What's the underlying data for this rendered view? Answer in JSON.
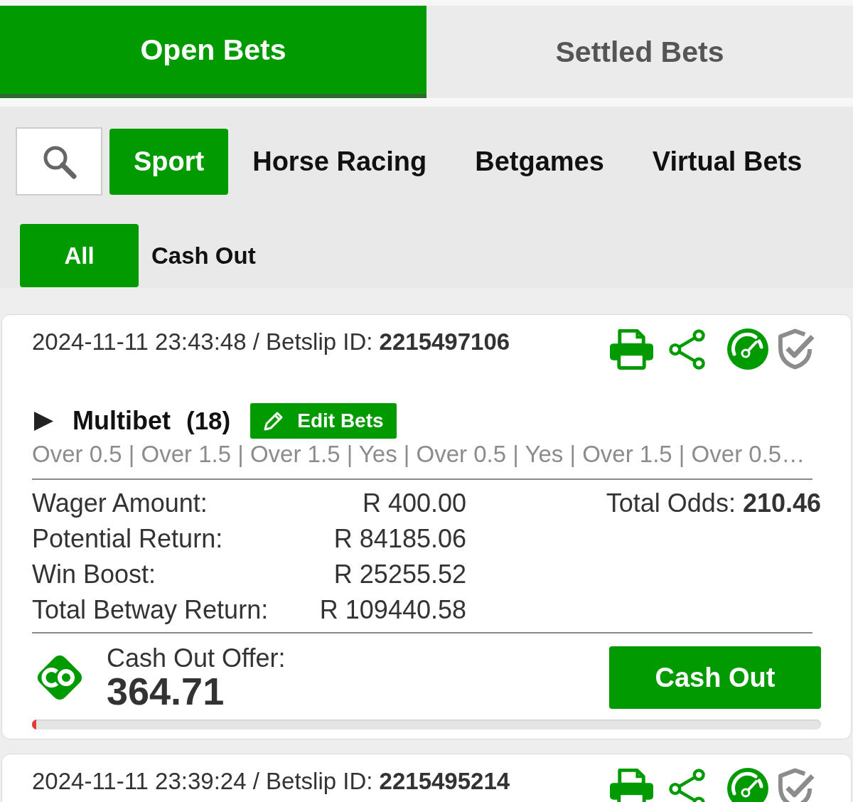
{
  "status_tabs": [
    {
      "label": "Open Bets",
      "selected": true
    },
    {
      "label": "Settled Bets",
      "selected": false
    }
  ],
  "category_tabs": [
    {
      "label": "Sport",
      "selected": true
    },
    {
      "label": "Horse Racing",
      "selected": false
    },
    {
      "label": "Betgames",
      "selected": false
    },
    {
      "label": "Virtual Bets",
      "selected": false
    }
  ],
  "filter_tabs": [
    {
      "label": "All",
      "selected": true
    },
    {
      "label": "Cash Out",
      "selected": false
    }
  ],
  "bets": [
    {
      "header": "2024-11-11 23:43:48 / Betslip ID: **2215497106**",
      "expanded": false,
      "title": "Multibet",
      "count": "(18)",
      "edit_button": "Edit Bets",
      "selections": "Over 0.5 | Over 1.5 | Over 1.5 | Yes | Over 0.5 | Yes | Over 1.5 | Over 0.5…",
      "details": [
        {
          "label": "Wager Amount:",
          "value": "R 400.00"
        },
        {
          "label": "Potential Return:",
          "value": "R 84185.06"
        },
        {
          "label": "Win Boost:",
          "value": "R 25255.52"
        },
        {
          "label": "Total Betway Return:",
          "value": "R 109440.58"
        }
      ],
      "total_odds": "Total Odds: **210.46**",
      "cash_out": {
        "label": "Cash Out Offer:",
        "amount": "364.71",
        "button": "Cash Out",
        "level": 0.005
      }
    },
    {
      "header": "2024-11-11 23:39:24 / Betslip ID: **2215495214**"
    }
  ]
}
